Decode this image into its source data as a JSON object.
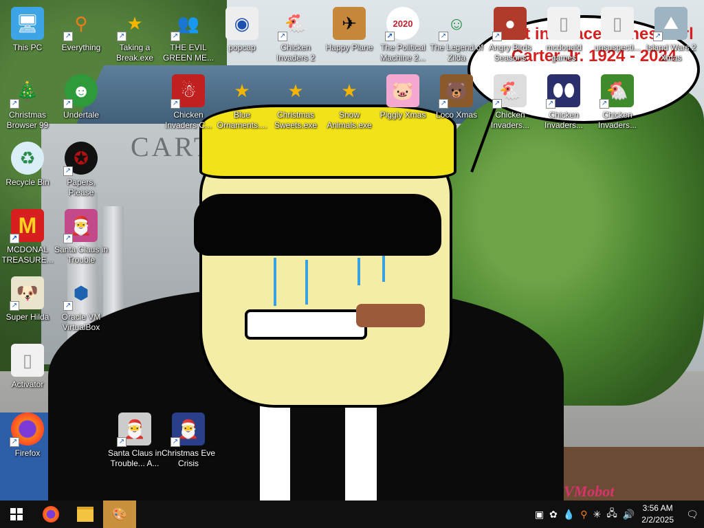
{
  "wallpaper": {
    "building_sign": "CARTER",
    "bubble_text": "Rest in Peace James Earl Carter Jr. 1924 - 2024",
    "watermark": "VMobot"
  },
  "desktop_icons": [
    {
      "label": "This PC",
      "icon": "computer-icon",
      "shortcut": false
    },
    {
      "label": "Everything",
      "icon": "search-icon",
      "shortcut": true
    },
    {
      "label": "Taking a Break.exe",
      "icon": "star-icon",
      "shortcut": true
    },
    {
      "label": "THE EVIL GREEN ME...",
      "icon": "messenger-icon",
      "shortcut": true
    },
    {
      "label": "popcap",
      "icon": "popcap-icon",
      "shortcut": false
    },
    {
      "label": "Chicken Invaders 2",
      "icon": "chicken-icon",
      "shortcut": true
    },
    {
      "label": "Happy Plane",
      "icon": "plane-icon",
      "shortcut": false
    },
    {
      "label": "The Political Machine 2...",
      "icon": "election-icon",
      "shortcut": true
    },
    {
      "label": "The Legend of Zilda",
      "icon": "zelda-icon",
      "shortcut": true
    },
    {
      "label": "Angry Birds Seasons",
      "icon": "angry-bird-icon",
      "shortcut": true
    },
    {
      "label": "mcdonald games",
      "icon": "folder-icon",
      "shortcut": false
    },
    {
      "label": "unsuspecti...",
      "icon": "file-icon",
      "shortcut": false
    },
    {
      "label": "Island Wars 2 Xmas",
      "icon": "island-icon",
      "shortcut": true
    },
    {
      "label": "Christmas Browser 99",
      "icon": "tree-icon",
      "shortcut": true
    },
    {
      "label": "Undertale",
      "icon": "undertale-icon",
      "shortcut": true
    },
    {
      "label": "Chicken Invaders C...",
      "icon": "snowman-icon",
      "shortcut": true
    },
    {
      "label": "Blue Ornaments....",
      "icon": "star-icon",
      "shortcut": false
    },
    {
      "label": "Christmas Sweets.exe",
      "icon": "star-icon",
      "shortcut": false
    },
    {
      "label": "Snow Animals.exe",
      "icon": "star-icon",
      "shortcut": false
    },
    {
      "label": "Piggly Xmas",
      "icon": "pig-icon",
      "shortcut": false
    },
    {
      "label": "Loco Xmas",
      "icon": "bear-icon",
      "shortcut": true
    },
    {
      "label": "Chicken Invaders...",
      "icon": "chicken-icon",
      "shortcut": true
    },
    {
      "label": "Chicken Invaders...",
      "icon": "eggs-icon",
      "shortcut": true
    },
    {
      "label": "Chicken Invaders...",
      "icon": "chicken-icon",
      "shortcut": true
    },
    {
      "label": "Recycle Bin",
      "icon": "recycle-bin-icon",
      "shortcut": false
    },
    {
      "label": "Papers, Please",
      "icon": "papers-icon",
      "shortcut": true
    },
    {
      "label": "MCDONAL TREASURE...",
      "icon": "mcdonalds-icon",
      "shortcut": true
    },
    {
      "label": "Santa Claus in Trouble",
      "icon": "santa-icon",
      "shortcut": true
    },
    {
      "label": "Super Hilda",
      "icon": "dog-icon",
      "shortcut": true
    },
    {
      "label": "Oracle VM VirtualBox",
      "icon": "virtualbox-icon",
      "shortcut": true
    },
    {
      "label": "Activator",
      "icon": "file-icon",
      "shortcut": false
    },
    {
      "label": "Firefox",
      "icon": "firefox-icon",
      "shortcut": true
    },
    {
      "label": "Santa Claus in Trouble... A...",
      "icon": "santa-icon",
      "shortcut": true
    },
    {
      "label": "Christmas Eve Crisis",
      "icon": "santa-icon",
      "shortcut": true
    }
  ],
  "taskbar": {
    "time": "3:56 AM",
    "date": "2/2/2025",
    "accent": "#c8913d"
  }
}
